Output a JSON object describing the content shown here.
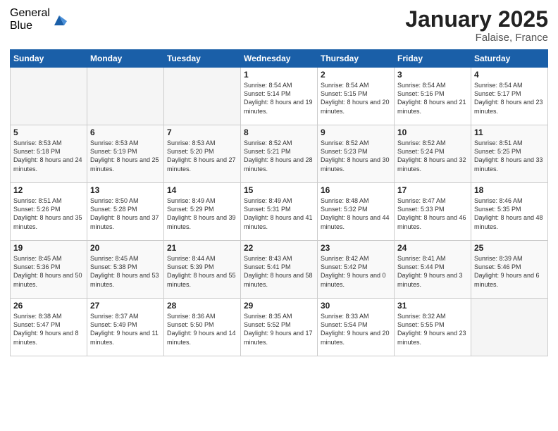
{
  "header": {
    "logo_general": "General",
    "logo_blue": "Blue",
    "month_title": "January 2025",
    "location": "Falaise, France"
  },
  "weekdays": [
    "Sunday",
    "Monday",
    "Tuesday",
    "Wednesday",
    "Thursday",
    "Friday",
    "Saturday"
  ],
  "weeks": [
    [
      {
        "num": "",
        "sunrise": "",
        "sunset": "",
        "daylight": "",
        "empty": true
      },
      {
        "num": "",
        "sunrise": "",
        "sunset": "",
        "daylight": "",
        "empty": true
      },
      {
        "num": "",
        "sunrise": "",
        "sunset": "",
        "daylight": "",
        "empty": true
      },
      {
        "num": "1",
        "sunrise": "Sunrise: 8:54 AM",
        "sunset": "Sunset: 5:14 PM",
        "daylight": "Daylight: 8 hours and 19 minutes."
      },
      {
        "num": "2",
        "sunrise": "Sunrise: 8:54 AM",
        "sunset": "Sunset: 5:15 PM",
        "daylight": "Daylight: 8 hours and 20 minutes."
      },
      {
        "num": "3",
        "sunrise": "Sunrise: 8:54 AM",
        "sunset": "Sunset: 5:16 PM",
        "daylight": "Daylight: 8 hours and 21 minutes."
      },
      {
        "num": "4",
        "sunrise": "Sunrise: 8:54 AM",
        "sunset": "Sunset: 5:17 PM",
        "daylight": "Daylight: 8 hours and 23 minutes."
      }
    ],
    [
      {
        "num": "5",
        "sunrise": "Sunrise: 8:53 AM",
        "sunset": "Sunset: 5:18 PM",
        "daylight": "Daylight: 8 hours and 24 minutes."
      },
      {
        "num": "6",
        "sunrise": "Sunrise: 8:53 AM",
        "sunset": "Sunset: 5:19 PM",
        "daylight": "Daylight: 8 hours and 25 minutes."
      },
      {
        "num": "7",
        "sunrise": "Sunrise: 8:53 AM",
        "sunset": "Sunset: 5:20 PM",
        "daylight": "Daylight: 8 hours and 27 minutes."
      },
      {
        "num": "8",
        "sunrise": "Sunrise: 8:52 AM",
        "sunset": "Sunset: 5:21 PM",
        "daylight": "Daylight: 8 hours and 28 minutes."
      },
      {
        "num": "9",
        "sunrise": "Sunrise: 8:52 AM",
        "sunset": "Sunset: 5:23 PM",
        "daylight": "Daylight: 8 hours and 30 minutes."
      },
      {
        "num": "10",
        "sunrise": "Sunrise: 8:52 AM",
        "sunset": "Sunset: 5:24 PM",
        "daylight": "Daylight: 8 hours and 32 minutes."
      },
      {
        "num": "11",
        "sunrise": "Sunrise: 8:51 AM",
        "sunset": "Sunset: 5:25 PM",
        "daylight": "Daylight: 8 hours and 33 minutes."
      }
    ],
    [
      {
        "num": "12",
        "sunrise": "Sunrise: 8:51 AM",
        "sunset": "Sunset: 5:26 PM",
        "daylight": "Daylight: 8 hours and 35 minutes."
      },
      {
        "num": "13",
        "sunrise": "Sunrise: 8:50 AM",
        "sunset": "Sunset: 5:28 PM",
        "daylight": "Daylight: 8 hours and 37 minutes."
      },
      {
        "num": "14",
        "sunrise": "Sunrise: 8:49 AM",
        "sunset": "Sunset: 5:29 PM",
        "daylight": "Daylight: 8 hours and 39 minutes."
      },
      {
        "num": "15",
        "sunrise": "Sunrise: 8:49 AM",
        "sunset": "Sunset: 5:31 PM",
        "daylight": "Daylight: 8 hours and 41 minutes."
      },
      {
        "num": "16",
        "sunrise": "Sunrise: 8:48 AM",
        "sunset": "Sunset: 5:32 PM",
        "daylight": "Daylight: 8 hours and 44 minutes."
      },
      {
        "num": "17",
        "sunrise": "Sunrise: 8:47 AM",
        "sunset": "Sunset: 5:33 PM",
        "daylight": "Daylight: 8 hours and 46 minutes."
      },
      {
        "num": "18",
        "sunrise": "Sunrise: 8:46 AM",
        "sunset": "Sunset: 5:35 PM",
        "daylight": "Daylight: 8 hours and 48 minutes."
      }
    ],
    [
      {
        "num": "19",
        "sunrise": "Sunrise: 8:45 AM",
        "sunset": "Sunset: 5:36 PM",
        "daylight": "Daylight: 8 hours and 50 minutes."
      },
      {
        "num": "20",
        "sunrise": "Sunrise: 8:45 AM",
        "sunset": "Sunset: 5:38 PM",
        "daylight": "Daylight: 8 hours and 53 minutes."
      },
      {
        "num": "21",
        "sunrise": "Sunrise: 8:44 AM",
        "sunset": "Sunset: 5:39 PM",
        "daylight": "Daylight: 8 hours and 55 minutes."
      },
      {
        "num": "22",
        "sunrise": "Sunrise: 8:43 AM",
        "sunset": "Sunset: 5:41 PM",
        "daylight": "Daylight: 8 hours and 58 minutes."
      },
      {
        "num": "23",
        "sunrise": "Sunrise: 8:42 AM",
        "sunset": "Sunset: 5:42 PM",
        "daylight": "Daylight: 9 hours and 0 minutes."
      },
      {
        "num": "24",
        "sunrise": "Sunrise: 8:41 AM",
        "sunset": "Sunset: 5:44 PM",
        "daylight": "Daylight: 9 hours and 3 minutes."
      },
      {
        "num": "25",
        "sunrise": "Sunrise: 8:39 AM",
        "sunset": "Sunset: 5:46 PM",
        "daylight": "Daylight: 9 hours and 6 minutes."
      }
    ],
    [
      {
        "num": "26",
        "sunrise": "Sunrise: 8:38 AM",
        "sunset": "Sunset: 5:47 PM",
        "daylight": "Daylight: 9 hours and 8 minutes."
      },
      {
        "num": "27",
        "sunrise": "Sunrise: 8:37 AM",
        "sunset": "Sunset: 5:49 PM",
        "daylight": "Daylight: 9 hours and 11 minutes."
      },
      {
        "num": "28",
        "sunrise": "Sunrise: 8:36 AM",
        "sunset": "Sunset: 5:50 PM",
        "daylight": "Daylight: 9 hours and 14 minutes."
      },
      {
        "num": "29",
        "sunrise": "Sunrise: 8:35 AM",
        "sunset": "Sunset: 5:52 PM",
        "daylight": "Daylight: 9 hours and 17 minutes."
      },
      {
        "num": "30",
        "sunrise": "Sunrise: 8:33 AM",
        "sunset": "Sunset: 5:54 PM",
        "daylight": "Daylight: 9 hours and 20 minutes."
      },
      {
        "num": "31",
        "sunrise": "Sunrise: 8:32 AM",
        "sunset": "Sunset: 5:55 PM",
        "daylight": "Daylight: 9 hours and 23 minutes."
      },
      {
        "num": "",
        "sunrise": "",
        "sunset": "",
        "daylight": "",
        "empty": true
      }
    ]
  ]
}
